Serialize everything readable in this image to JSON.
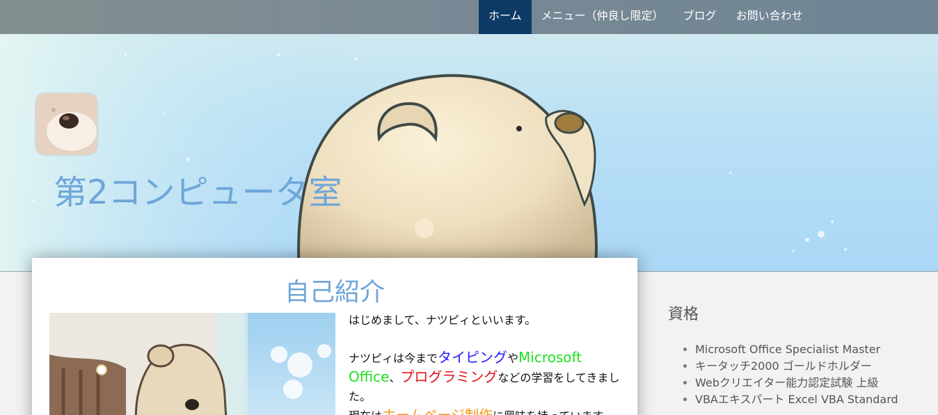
{
  "nav": {
    "items": [
      {
        "label": "ホーム",
        "active": true
      },
      {
        "label": "メニュー（仲良し限定）",
        "active": false
      },
      {
        "label": "ブログ",
        "active": false
      },
      {
        "label": "お問い合わせ",
        "active": false
      }
    ]
  },
  "site": {
    "title": "第2コンピュータ室"
  },
  "main": {
    "title": "自己紹介",
    "intro": {
      "line1": "はじめまして、ナツピィといいます。",
      "p2_a": "ナツピィは今まで",
      "p2_typing": "タイピング",
      "p2_ya": "や",
      "p2_office": "Microsoft Office",
      "p2_comma": "、",
      "p2_programming": "プログラミング",
      "p2_tail": "などの学習をしてきました。",
      "p3_a": "現在は",
      "p3_hp": "ホームページ制作",
      "p3_tail": "に興味を持っています。"
    }
  },
  "sidebar": {
    "title": "資格",
    "items": [
      "Microsoft Office Specialist Master",
      "キータッチ2000 ゴールドホルダー",
      "Webクリエイター能力認定試験 上級",
      "VBAエキスパート Excel VBA Standard"
    ]
  },
  "colors": {
    "nav_active": "#0e3a66",
    "title_blue": "#6fa6d9",
    "typing": "#1a1aff",
    "office": "#1ee01e",
    "programming": "#e0131a",
    "homepage": "#f39a1a"
  }
}
